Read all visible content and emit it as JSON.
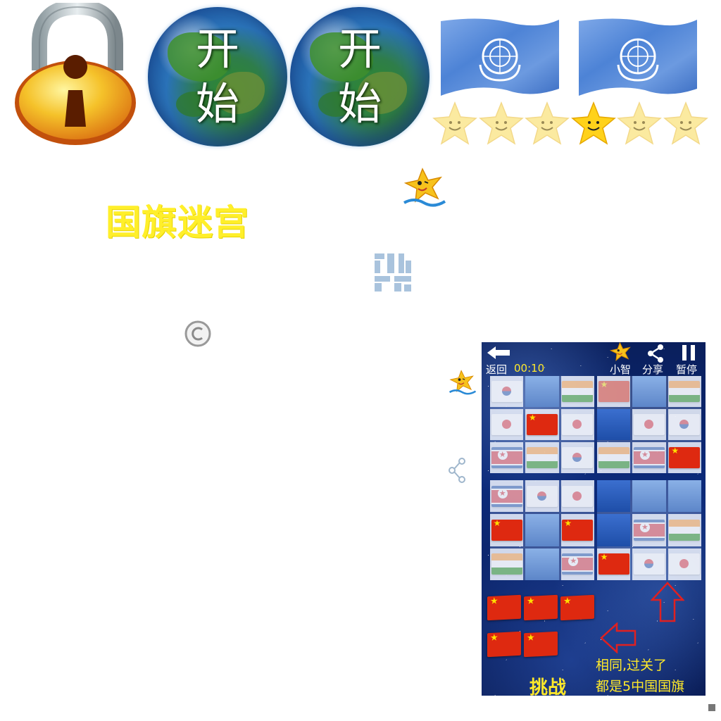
{
  "title": "国旗迷宫",
  "start_button": {
    "line1": "开",
    "line2": "始"
  },
  "stars": {
    "total": 6,
    "highlighted_index": 3
  },
  "phone_preview": {
    "back_label": "返回",
    "timer": "00:10",
    "hint_label": "小智",
    "share_label": "分享",
    "pause_label": "暂停",
    "caption_line1": "相同,过关了",
    "caption_line2": "都是5中国国旗",
    "challenge_label": "挑战",
    "panels": [
      [
        "kr-f",
        "sky",
        "in-f",
        "jp-f",
        "cn",
        "jp-f",
        "kp-f",
        "in-f",
        "kr-f"
      ],
      [
        "cn-f",
        "sky",
        "in-f",
        "sky2",
        "jp-f",
        "kr-f",
        "in-f",
        "kp-f",
        "cn"
      ],
      [
        "kp-f",
        "kr-f",
        "jp-f",
        "cn",
        "sky",
        "cn",
        "in-f",
        "sky",
        "kp-f"
      ],
      [
        "sky2",
        "sky",
        "sky",
        "sky2",
        "kp-f",
        "in-f",
        "cn",
        "kr-f",
        "jp-f"
      ]
    ]
  },
  "colors": {
    "title": "#ffef2a",
    "phone_background": "#0c2a7a",
    "caption": "#ffe92a",
    "arrow": "#e02020"
  },
  "icons": [
    "lock-icon",
    "globe-icon",
    "un-flag-icon",
    "smiley-star-icon",
    "mascot-star-icon",
    "copyright-icon",
    "share-icon",
    "back-arrow-icon",
    "pause-icon",
    "grid-icon"
  ]
}
